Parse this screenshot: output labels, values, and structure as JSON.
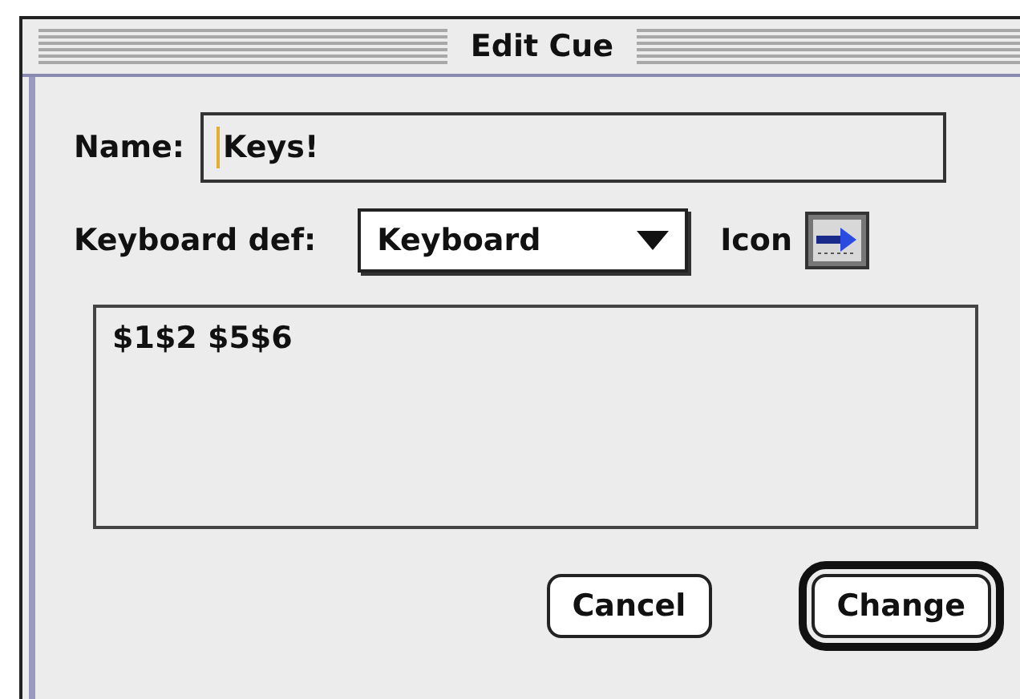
{
  "window": {
    "title": "Edit Cue"
  },
  "name_field": {
    "label": "Name:",
    "value": "Keys!"
  },
  "keyboard_def": {
    "label": "Keyboard def:",
    "value": "Keyboard",
    "icon_label": "Icon"
  },
  "definition_text": "$1$2 $5$6",
  "buttons": [
    {
      "label": "Cancel",
      "default": false
    },
    {
      "label": "Change",
      "default": true
    }
  ]
}
